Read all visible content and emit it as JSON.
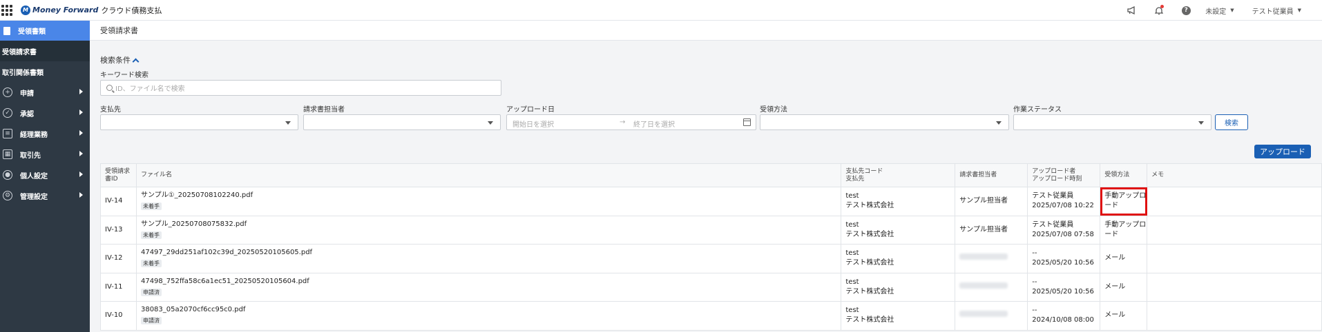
{
  "header": {
    "brand": "Money Forward",
    "brand_mark": "M",
    "product": "クラウド債務支払",
    "menus": [
      {
        "label": "未設定"
      },
      {
        "label": "テスト従業員"
      }
    ]
  },
  "sidebar": {
    "section": "受領書類",
    "subitems": [
      "受領請求書",
      "取引関係書類"
    ],
    "items": [
      {
        "label": "申請",
        "icon": "plus-circle-icon"
      },
      {
        "label": "承認",
        "icon": "check-circle-icon"
      },
      {
        "label": "経理業務",
        "icon": "ledger-icon"
      },
      {
        "label": "取引先",
        "icon": "building-icon"
      },
      {
        "label": "個人設定",
        "icon": "person-icon"
      },
      {
        "label": "管理設定",
        "icon": "gear-icon"
      }
    ]
  },
  "page": {
    "title": "受領請求書"
  },
  "filters": {
    "title": "検索条件",
    "keyword_label": "キーワード検索",
    "keyword_placeholder": "ID、ファイル名で検索",
    "payee_label": "支払先",
    "assignee_label": "請求書担当者",
    "upload_date_label": "アップロード日",
    "date_start_placeholder": "開始日を選択",
    "date_sep": "→",
    "date_end_placeholder": "終了日を選択",
    "method_label": "受領方法",
    "status_label": "作業ステータス",
    "search_button": "検索"
  },
  "upload_button": "アップロード",
  "table": {
    "headers": {
      "id": "受領請求書ID",
      "file": "ファイル名",
      "payee_code": "支払先コード",
      "payee": "支払先",
      "assignee": "請求書担当者",
      "uploader": "アップロード者",
      "uploaded_at": "アップロード時刻",
      "method": "受領方法",
      "memo": "メモ"
    },
    "rows": [
      {
        "id": "IV-14",
        "file": "サンプル①_20250708102240.pdf",
        "status": "未着手",
        "code": "test",
        "payee": "テスト株式会社",
        "assignee": "サンプル担当者",
        "uploader": "テスト従業員",
        "time": "2025/07/08 10:22",
        "method": "手動アップロード",
        "highlight": true
      },
      {
        "id": "IV-13",
        "file": "サンプル_20250708075832.pdf",
        "status": "未着手",
        "code": "test",
        "payee": "テスト株式会社",
        "assignee": "サンプル担当者",
        "uploader": "テスト従業員",
        "time": "2025/07/08 07:58",
        "method": "手動アップロード",
        "highlight": false
      },
      {
        "id": "IV-12",
        "file": "47497_29dd251af102c39d_20250520105605.pdf",
        "status": "未着手",
        "code": "test",
        "payee": "テスト株式会社",
        "assignee": "",
        "uploader": "--",
        "time": "2025/05/20 10:56",
        "method": "メール",
        "highlight": false
      },
      {
        "id": "IV-11",
        "file": "47498_752ffa58c6a1ec51_20250520105604.pdf",
        "status": "申請済",
        "code": "test",
        "payee": "テスト株式会社",
        "assignee": "",
        "uploader": "--",
        "time": "2025/05/20 10:56",
        "method": "メール",
        "highlight": false
      },
      {
        "id": "IV-10",
        "file": "38083_05a2070cf6cc95c0.pdf",
        "status": "申請済",
        "code": "test",
        "payee": "テスト株式会社",
        "assignee": "",
        "uploader": "--",
        "time": "2024/10/08 08:00",
        "method": "メール",
        "highlight": false
      }
    ]
  }
}
